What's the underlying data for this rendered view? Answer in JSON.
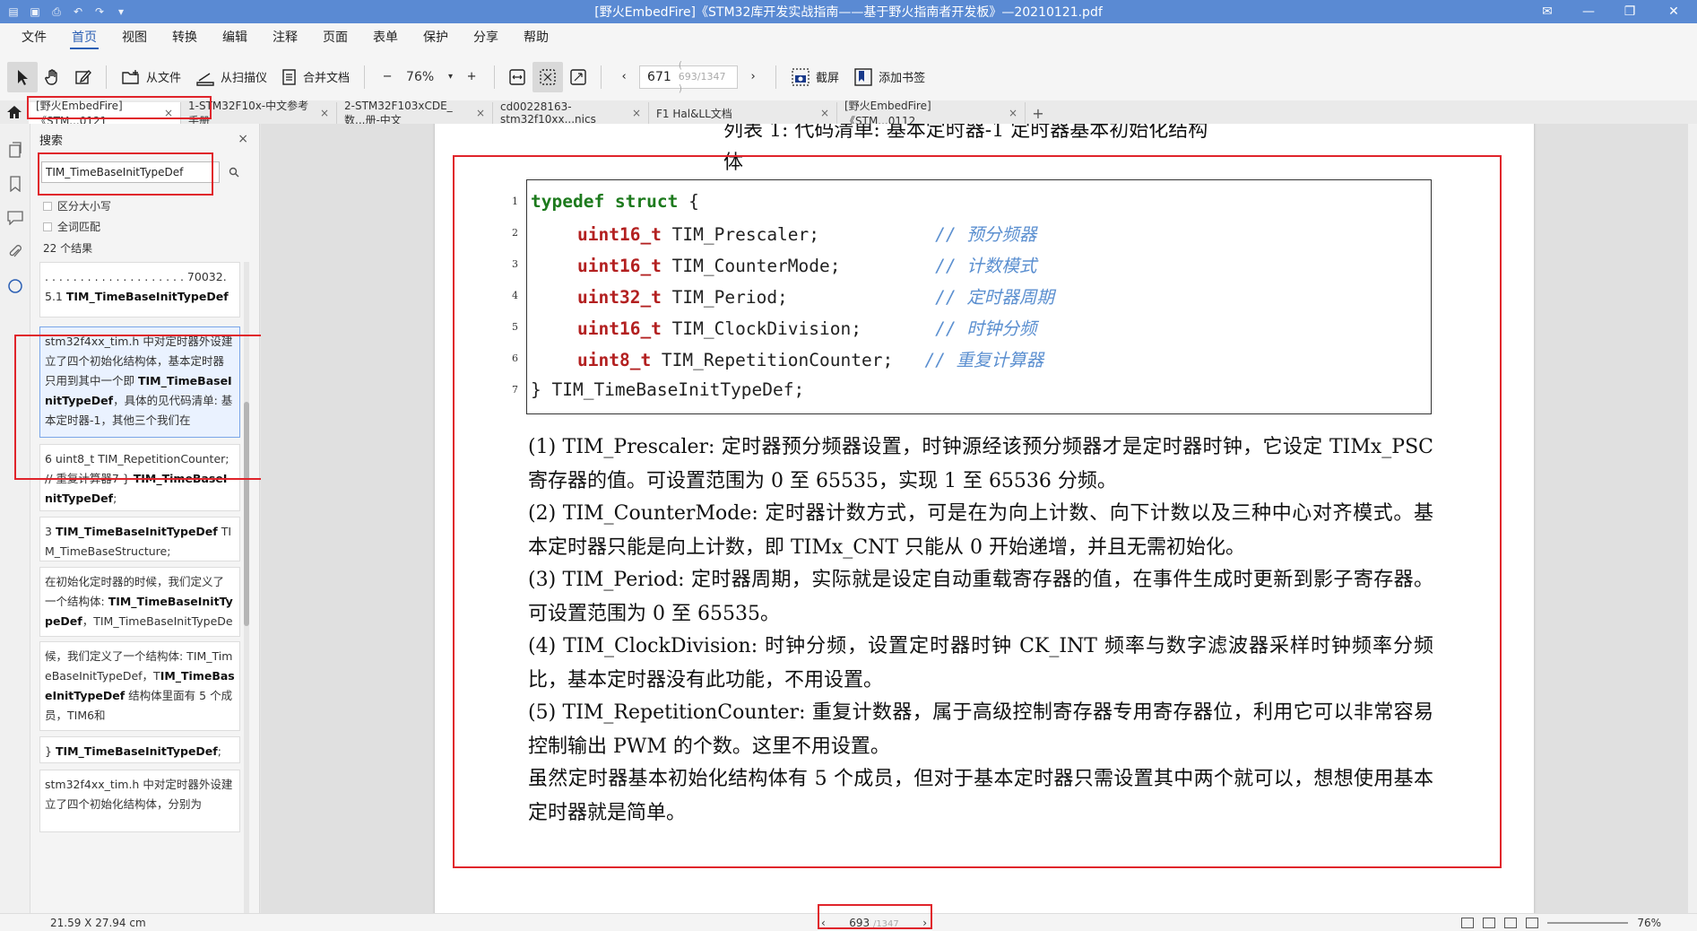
{
  "window": {
    "title": "[野火EmbedFire]《STM32库开发实战指南——基于野火指南者开发板》—20210121.pdf"
  },
  "menu": [
    "文件",
    "首页",
    "视图",
    "转换",
    "编辑",
    "注释",
    "页面",
    "表单",
    "保护",
    "分享",
    "帮助"
  ],
  "toolbar": {
    "from_file": "从文件",
    "from_scanner": "从扫描仪",
    "merge_docs": "合并文档",
    "zoom": "76%",
    "zoom_minus": "−",
    "zoom_plus": "+",
    "page_current": "671",
    "page_total": "( 693/1347 )",
    "screenshot": "截屏",
    "add_bookmark": "添加书签"
  },
  "tabs": [
    {
      "label": "[野火EmbedFire]《STM...0121",
      "active": true
    },
    {
      "label": "1-STM32F10x-中文参考手册",
      "active": false
    },
    {
      "label": "2-STM32F103xCDE_数...册-中文",
      "active": false
    },
    {
      "label": "cd00228163-stm32f10xx...nics",
      "active": false
    },
    {
      "label": "F1 Hal&LL文档",
      "active": false
    },
    {
      "label": "[野火EmbedFire]《STM...0112",
      "active": false
    }
  ],
  "search": {
    "title": "搜索",
    "query": "TIM_TimeBaseInitTypeDef",
    "opt_case": "区分大小写",
    "opt_whole": "全词匹配",
    "count": "22 个结果",
    "results": [
      {
        "pre": ". . . . . . . . . . . . . . . . . . . . 70032.5.1 ",
        "hit": "TIM_TimeBaseInitTypeDef",
        "post": " . . . . . . . . . ."
      },
      {
        "pre": "stm32f4xx_tim.h 中对定时器外设建立了四个初始化结构体，基本定时器只用到其中一个即 ",
        "hit": "TIM_TimeBaseInitTypeDef",
        "post": "，具体的见代码清单: 基本定时器-1，其他三个我们在"
      },
      {
        "pre": "6 uint8_t TIM_RepetitionCounter; // 重复计算器7 } ",
        "hit": "TIM_TimeBaseInitTypeDef",
        "post": ";"
      },
      {
        "pre": "3 ",
        "hit": "TIM_TimeBaseInitTypeDef",
        "post": " TIM_TimeBaseStructure;"
      },
      {
        "pre": "在初始化定时器的时候，我们定义了一个结构体: ",
        "hit": "TIM_TimeBaseInitTypeDef",
        "post": "，TIM_TimeBaseInitTypeDef"
      },
      {
        "pre": "候，我们定义了一个结构体: TIM_TimeBaseInitTypeDef，T",
        "hit": "IM_TimeBaseInitTypeDef",
        "post": " 结构体里面有 5 个成员，TIM6和"
      },
      {
        "pre": "} ",
        "hit": "TIM_TimeBaseInitTypeDef",
        "post": ";"
      },
      {
        "pre": "stm32f4xx_tim.h 中对定时器外设建立了四个初始化结构体，分别为",
        "hit": "",
        "post": ""
      }
    ]
  },
  "document": {
    "caption_line1": "列表 1: 代码清单: 基本定时器-1 定时器基本初始化结构",
    "caption_line2": "体",
    "code": [
      {
        "n": "1",
        "kw": "typedef struct",
        "rest": " {",
        "cm": ""
      },
      {
        "n": "2",
        "ty": "uint16_t",
        "rest": " TIM_Prescaler;           ",
        "cm": "// 预分频器"
      },
      {
        "n": "3",
        "ty": "uint16_t",
        "rest": " TIM_CounterMode;         ",
        "cm": "// 计数模式"
      },
      {
        "n": "4",
        "ty": "uint32_t",
        "rest": " TIM_Period;              ",
        "cm": "// 定时器周期"
      },
      {
        "n": "5",
        "ty": "uint16_t",
        "rest": " TIM_ClockDivision;       ",
        "cm": "// 时钟分频"
      },
      {
        "n": "6",
        "ty": "uint8_t",
        "rest": " TIM_RepetitionCounter;   ",
        "cm": "// 重复计算器"
      },
      {
        "n": "7",
        "kw": "",
        "rest": "} TIM_TimeBaseInitTypeDef;",
        "cm": ""
      }
    ],
    "paragraphs": [
      "(1) TIM_Prescaler: 定时器预分频器设置，时钟源经该预分频器才是定时器时钟，它设定 TIMx_PSC 寄存器的值。可设置范围为 0 至 65535，实现 1 至 65536 分频。",
      "(2) TIM_CounterMode: 定时器计数方式，可是在为向上计数、向下计数以及三种中心对齐模式。基本定时器只能是向上计数，即 TIMx_CNT 只能从 0 开始递增，并且无需初始化。",
      "(3) TIM_Period: 定时器周期，实际就是设定自动重载寄存器的值，在事件生成时更新到影子寄存器。可设置范围为 0 至 65535。",
      "(4) TIM_ClockDivision: 时钟分频，设置定时器时钟 CK_INT 频率与数字滤波器采样时钟频率分频比，基本定时器没有此功能，不用设置。",
      "(5) TIM_RepetitionCounter: 重复计数器，属于高级控制寄存器专用寄存器位，利用它可以非常容易控制输出 PWM 的个数。这里不用设置。",
      "虽然定时器基本初始化结构体有 5 个成员，但对于基本定时器只需设置其中两个就可以，想想使用基本定时器就是简单。"
    ]
  },
  "status": {
    "page_size": "21.59 X 27.94 cm",
    "page_current": "693",
    "page_total": "/1347",
    "zoom": "76%"
  },
  "colors": {
    "titlebar": "#5a8ad3",
    "accent": "#2b5fb4",
    "annotation_red": "#e0242b"
  }
}
